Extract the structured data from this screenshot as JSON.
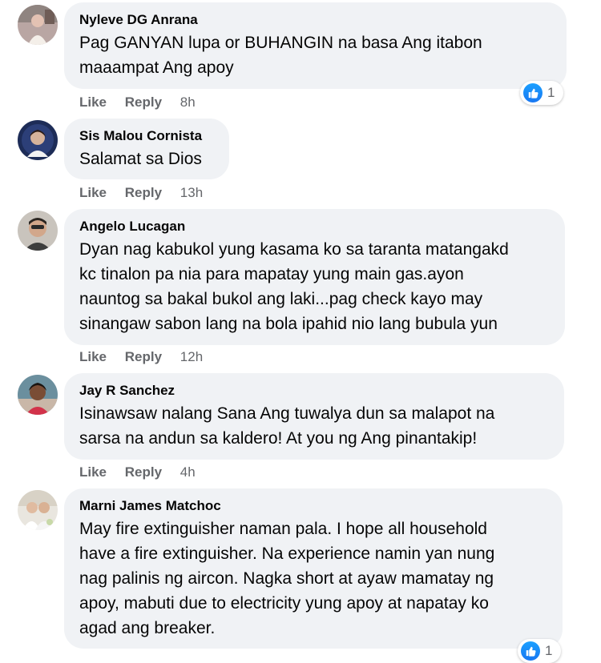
{
  "comments": [
    {
      "author": "Nyleve DG Anrana",
      "lines": [
        "Pag GANYAN lupa or BUHANGIN na basa Ang itabon",
        "maaampat Ang apoy"
      ],
      "like_label": "Like",
      "reply_label": "Reply",
      "time": "8h",
      "reaction_count": "1"
    },
    {
      "author": "Sis Malou Cornista",
      "lines": [
        "Salamat sa Dios"
      ],
      "like_label": "Like",
      "reply_label": "Reply",
      "time": "13h"
    },
    {
      "author": "Angelo Lucagan",
      "lines": [
        "Dyan nag kabukol yung kasama ko sa taranta matangakd",
        "kc tinalon pa nia para mapatay yung main gas.ayon",
        "nauntog sa bakal bukol ang laki...pag check kayo may",
        "sinangaw sabon lang na bola ipahid nio lang bubula yun"
      ],
      "like_label": "Like",
      "reply_label": "Reply",
      "time": "12h"
    },
    {
      "author": "Jay R Sanchez",
      "lines": [
        "Isinawsaw nalang Sana Ang tuwalya dun sa malapot na",
        "sarsa na andun sa kaldero! At you ng Ang pinantakip!"
      ],
      "like_label": "Like",
      "reply_label": "Reply",
      "time": "4h"
    },
    {
      "author": "Marni James Matchoc",
      "lines": [
        "May fire extinguisher naman pala. I hope all household",
        "have a fire extinguisher. Na experience namin yan nung",
        "nag palinis ng aircon. Nagka short at ayaw mamatay ng",
        "apoy, mabuti due to electricity yung apoy at napatay ko",
        "agad ang breaker."
      ],
      "reaction_count": "1"
    }
  ],
  "colors": {
    "bubble": "#f0f2f5",
    "meta_text": "#65676b",
    "like_blue": "#1877f2"
  },
  "icons": {
    "reaction": "like-thumb-icon"
  }
}
